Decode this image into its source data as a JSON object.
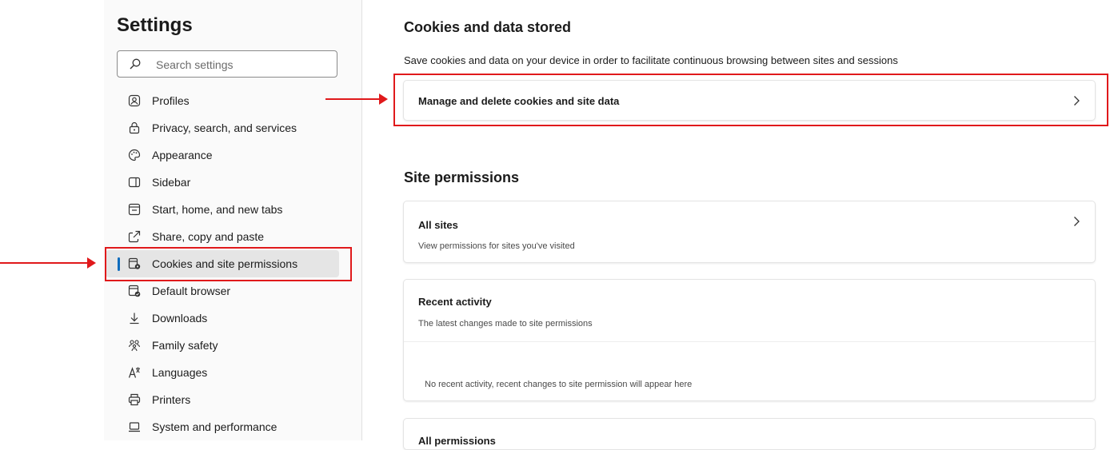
{
  "sidebar": {
    "title": "Settings",
    "search_placeholder": "Search settings",
    "items": [
      {
        "label": "Profiles",
        "icon": "profile-icon"
      },
      {
        "label": "Privacy, search, and services",
        "icon": "lock-icon"
      },
      {
        "label": "Appearance",
        "icon": "palette-icon"
      },
      {
        "label": "Sidebar",
        "icon": "sidebar-icon"
      },
      {
        "label": "Start, home, and new tabs",
        "icon": "home-tabs-icon"
      },
      {
        "label": "Share, copy and paste",
        "icon": "share-icon"
      },
      {
        "label": "Cookies and site permissions",
        "icon": "cookies-gear-icon",
        "active": true
      },
      {
        "label": "Default browser",
        "icon": "default-browser-icon"
      },
      {
        "label": "Downloads",
        "icon": "download-icon"
      },
      {
        "label": "Family safety",
        "icon": "family-icon"
      },
      {
        "label": "Languages",
        "icon": "languages-icon"
      },
      {
        "label": "Printers",
        "icon": "printer-icon"
      },
      {
        "label": "System and performance",
        "icon": "laptop-icon"
      }
    ]
  },
  "main": {
    "cookies_section": {
      "title": "Cookies and data stored",
      "description": "Save cookies and data on your device in order to facilitate continuous browsing between sites and sessions",
      "manage_label": "Manage and delete cookies and site data"
    },
    "permissions_section": {
      "title": "Site permissions",
      "all_sites_title": "All sites",
      "all_sites_sub": "View permissions for sites you've visited",
      "recent_title": "Recent activity",
      "recent_sub": "The latest changes made to site permissions",
      "recent_empty": "No recent activity, recent changes to site permission will appear here",
      "all_permissions_title": "All permissions"
    }
  },
  "colors": {
    "accent": "#0f6cbd",
    "annotation": "#e0191b"
  }
}
